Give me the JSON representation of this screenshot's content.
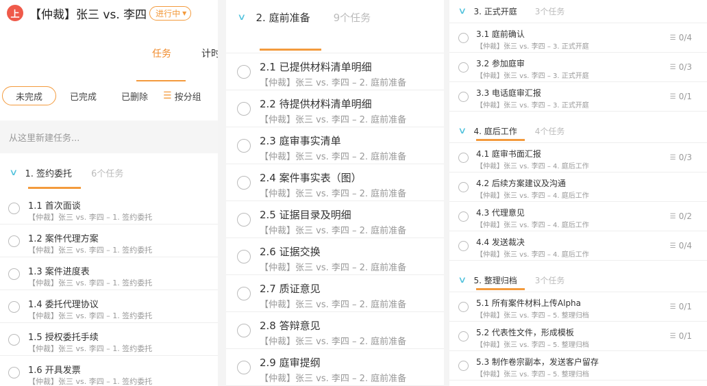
{
  "app": {
    "logo_glyph": "上",
    "title": "【仲裁】张三 vs. 李四",
    "status": "进行中"
  },
  "tabs": [
    {
      "label": "任务",
      "active": true
    },
    {
      "label": "计时",
      "active": false
    }
  ],
  "filters": {
    "incomplete": "未完成",
    "completed": "已完成",
    "deleted": "已删除",
    "group_by": "按分组"
  },
  "new_task_placeholder": "从这里新建任务...",
  "sections": {
    "s1": {
      "name": "1. 签约委托",
      "count": "6个任务",
      "tasks": [
        {
          "title": "1.1 首次面谈",
          "sub": "【仲裁】张三 vs. 李四 – 1. 签约委托"
        },
        {
          "title": "1.2 案件代理方案",
          "sub": "【仲裁】张三 vs. 李四 – 1. 签约委托"
        },
        {
          "title": "1.3 案件进度表",
          "sub": "【仲裁】张三 vs. 李四 – 1. 签约委托"
        },
        {
          "title": "1.4 委托代理协议",
          "sub": "【仲裁】张三 vs. 李四 – 1. 签约委托"
        },
        {
          "title": "1.5 授权委托手续",
          "sub": "【仲裁】张三 vs. 李四 – 1. 签约委托"
        },
        {
          "title": "1.6 开具发票",
          "sub": "【仲裁】张三 vs. 李四 – 1. 签约委托"
        }
      ]
    },
    "s2": {
      "name": "2. 庭前准备",
      "count": "9个任务",
      "tasks": [
        {
          "title": "2.1 已提供材料清单明细",
          "sub": "【仲裁】张三 vs. 李四 – 2. 庭前准备"
        },
        {
          "title": "2.2 待提供材料清单明细",
          "sub": "【仲裁】张三 vs. 李四 – 2. 庭前准备"
        },
        {
          "title": "2.3 庭审事实清单",
          "sub": "【仲裁】张三 vs. 李四 – 2. 庭前准备"
        },
        {
          "title": "2.4 案件事实表（图）",
          "sub": "【仲裁】张三 vs. 李四 – 2. 庭前准备"
        },
        {
          "title": "2.5 证据目录及明细",
          "sub": "【仲裁】张三 vs. 李四 – 2. 庭前准备"
        },
        {
          "title": "2.6 证据交换",
          "sub": "【仲裁】张三 vs. 李四 – 2. 庭前准备"
        },
        {
          "title": "2.7 质证意见",
          "sub": "【仲裁】张三 vs. 李四 – 2. 庭前准备"
        },
        {
          "title": "2.8 答辩意见",
          "sub": "【仲裁】张三 vs. 李四 – 2. 庭前准备"
        },
        {
          "title": "2.9 庭审提纲",
          "sub": "【仲裁】张三 vs. 李四 – 2. 庭前准备"
        }
      ]
    },
    "s3": {
      "name": "3. 正式开庭",
      "count": "3个任务",
      "tasks": [
        {
          "title": "3.1 庭前确认",
          "sub": "【仲裁】张三 vs. 李四 – 3. 正式开庭",
          "progress": "0/4"
        },
        {
          "title": "3.2 参加庭审",
          "sub": "【仲裁】张三 vs. 李四 – 3. 正式开庭",
          "progress": "0/3"
        },
        {
          "title": "3.3 电话庭审汇报",
          "sub": "【仲裁】张三 vs. 李四 – 3. 正式开庭",
          "progress": "0/1"
        }
      ]
    },
    "s4": {
      "name": "4. 庭后工作",
      "count": "4个任务",
      "tasks": [
        {
          "title": "4.1 庭审书面汇报",
          "sub": "【仲裁】张三 vs. 李四 – 4. 庭后工作",
          "progress": "0/3"
        },
        {
          "title": "4.2 后续方案建议及沟通",
          "sub": "【仲裁】张三 vs. 李四 – 4. 庭后工作",
          "progress": ""
        },
        {
          "title": "4.3 代理意见",
          "sub": "【仲裁】张三 vs. 李四 – 4. 庭后工作",
          "progress": "0/2"
        },
        {
          "title": "4.4 发送裁决",
          "sub": "【仲裁】张三 vs. 李四 – 4. 庭后工作",
          "progress": "0/4"
        }
      ]
    },
    "s5": {
      "name": "5. 整理归档",
      "count": "3个任务",
      "tasks": [
        {
          "title": "5.1 所有案件材料上传Alpha",
          "sub": "【仲裁】张三 vs. 李四 – 5. 整理归档",
          "progress": "0/1"
        },
        {
          "title": "5.2 代表性文件，形成模板",
          "sub": "【仲裁】张三 vs. 李四 – 5. 整理归档",
          "progress": "0/1"
        },
        {
          "title": "5.3 制作卷宗副本，发送客户留存",
          "sub": "【仲裁】张三 vs. 李四 – 5. 整理归档",
          "progress": ""
        }
      ]
    }
  },
  "colors": {
    "accent": "#f39a3c",
    "chevron": "#4fc1dc",
    "logo": "#ef5a4a"
  },
  "icons": {
    "chevron": "chevron-down-icon",
    "checkbox": "circle-checkbox-icon",
    "subtask": "list-icon"
  }
}
